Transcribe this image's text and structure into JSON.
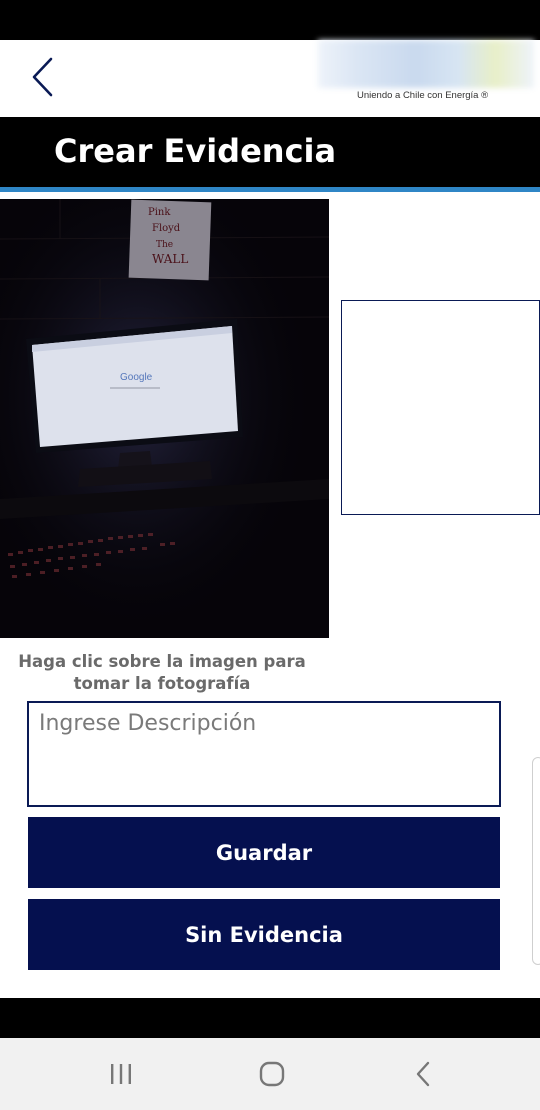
{
  "header": {
    "back_icon": "chevron-left-icon",
    "brand_tagline": "Uniendo a Chile con Energía ®"
  },
  "title_bar": {
    "title": "Crear Evidencia",
    "accent_color": "#2f86c6"
  },
  "evidence": {
    "photo_content": "dark room with monitor showing Google",
    "photo_screen_text": "Google",
    "poster_text": "Pink Floyd The Wall",
    "hint": "Haga clic sobre la imagen para tomar la fotografía"
  },
  "form": {
    "description_placeholder": "Ingrese Descripción",
    "description_value": ""
  },
  "buttons": {
    "save_label": "Guardar",
    "no_evidence_label": "Sin Evidencia",
    "color": "#05104f"
  },
  "system_nav": {
    "recents_icon": "recent-apps-icon",
    "home_icon": "home-icon",
    "back_icon": "system-back-icon"
  }
}
